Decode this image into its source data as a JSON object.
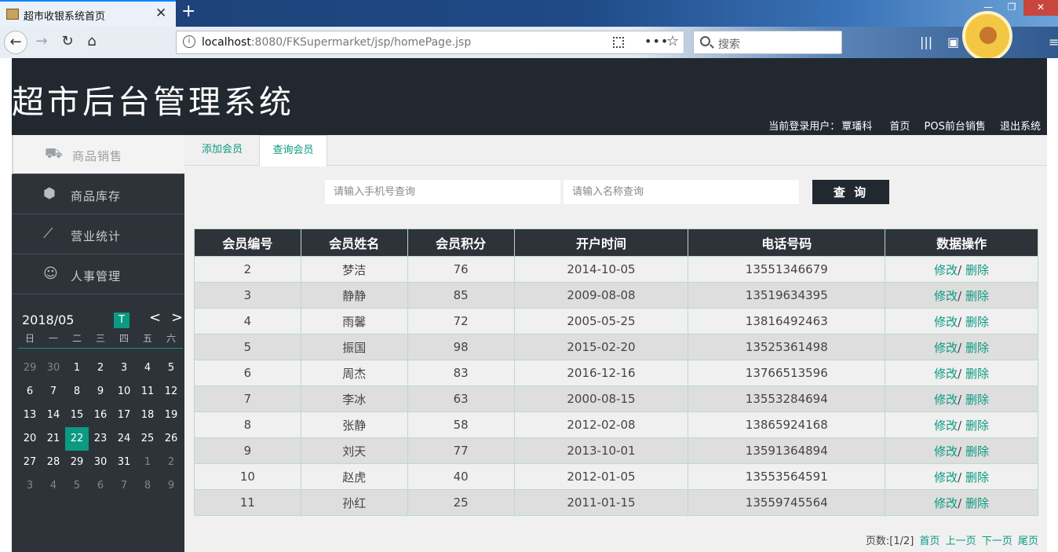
{
  "browser": {
    "tab_title": "超市收银系统首页",
    "close_glyph": "✕",
    "newtab_glyph": "+",
    "url_host": "localhost",
    "url_rest": ":8080/FKSupermarket/jsp/homePage.jsp",
    "search_placeholder": "搜索",
    "more_glyph": "•••",
    "star_glyph": "☆"
  },
  "header": {
    "title": "超市后台管理系统",
    "user_label": "当前登录用户：",
    "user_name": "覃璠科",
    "links": [
      "首页",
      "POS前台销售",
      "退出系统"
    ]
  },
  "sidebar": {
    "items": [
      {
        "label": "商品销售",
        "icon": "cart-icon",
        "glyph": "🛒"
      },
      {
        "label": "商品库存",
        "icon": "box-icon",
        "glyph": "⬢"
      },
      {
        "label": "营业统计",
        "icon": "chart-icon",
        "glyph": "📈"
      },
      {
        "label": "人事管理",
        "icon": "user-icon",
        "glyph": "👤"
      }
    ]
  },
  "calendar": {
    "month": "2018/05",
    "today_label": "T",
    "prev": "<",
    "next": ">",
    "weekdays": [
      "日",
      "一",
      "二",
      "三",
      "四",
      "五",
      "六"
    ],
    "days": [
      "29",
      "30",
      "1",
      "2",
      "3",
      "4",
      "5",
      "6",
      "7",
      "8",
      "9",
      "10",
      "11",
      "12",
      "13",
      "14",
      "15",
      "16",
      "17",
      "18",
      "19",
      "20",
      "21",
      "22",
      "23",
      "24",
      "25",
      "26",
      "27",
      "28",
      "29",
      "30",
      "31",
      "1",
      "2",
      "3",
      "4",
      "5",
      "6",
      "7",
      "8",
      "9"
    ],
    "selected": "22"
  },
  "tabs": [
    "添加会员",
    "查询会员"
  ],
  "search": {
    "phone_placeholder": "请输入手机号查询",
    "name_placeholder": "请输入名称查询",
    "button": "查 询"
  },
  "table": {
    "headers": [
      "会员编号",
      "会员姓名",
      "会员积分",
      "开户时间",
      "电话号码",
      "数据操作"
    ],
    "rows": [
      [
        "2",
        "梦洁",
        "76",
        "2014-10-05",
        "13551346679"
      ],
      [
        "3",
        "静静",
        "85",
        "2009-08-08",
        "13519634395"
      ],
      [
        "4",
        "雨馨",
        "72",
        "2005-05-25",
        "13816492463"
      ],
      [
        "5",
        "振国",
        "98",
        "2015-02-20",
        "13525361498"
      ],
      [
        "6",
        "周杰",
        "83",
        "2016-12-16",
        "13766513596"
      ],
      [
        "7",
        "李冰",
        "63",
        "2000-08-15",
        "13553284694"
      ],
      [
        "8",
        "张静",
        "58",
        "2012-02-08",
        "13865924168"
      ],
      [
        "9",
        "刘天",
        "77",
        "2013-10-01",
        "13591364894"
      ],
      [
        "10",
        "赵虎",
        "40",
        "2012-01-05",
        "13553564591"
      ],
      [
        "11",
        "孙红",
        "25",
        "2011-01-15",
        "13559745564"
      ]
    ],
    "edit_label": "修改",
    "sep_label": "/ ",
    "delete_label": "删除"
  },
  "pager": {
    "info": "页数:[1/2]",
    "first": "首页",
    "prev": "上一页",
    "next": "下一页",
    "last": "尾页"
  },
  "colors": {
    "accent": "#0b9a82",
    "dark": "#212830",
    "sidebar": "#2d3339"
  }
}
